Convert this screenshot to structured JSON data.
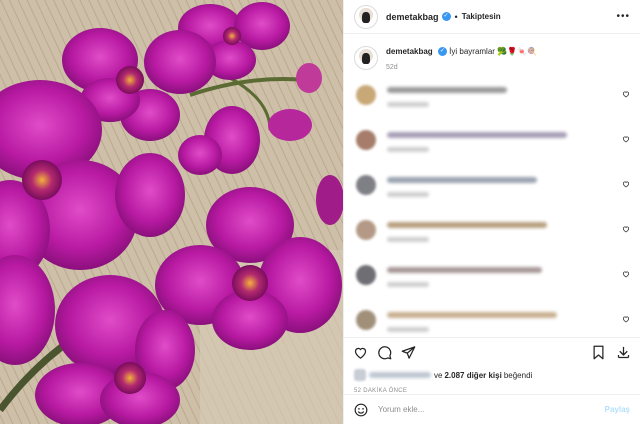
{
  "header": {
    "username": "demetakbag",
    "verified_glyph": "✓",
    "separator": "•",
    "follow_status": "Takiptesin",
    "more_glyph": "•••"
  },
  "caption": {
    "username": "demetakbag",
    "text": "İyi bayramlar",
    "emojis": [
      "broccoli-emoji",
      "rose-emoji",
      "sweets-emoji",
      "lollipop-emoji"
    ],
    "time": "52d"
  },
  "comments": [
    {
      "avatar_color": "#c9a878",
      "text_color": "#9a9a9a",
      "width": 120
    },
    {
      "avatar_color": "#a67c6a",
      "text_color": "#a8a0b8",
      "width": 180
    },
    {
      "avatar_color": "#7f7f86",
      "text_color": "#9aa3b0",
      "width": 150
    },
    {
      "avatar_color": "#b49a86",
      "text_color": "#b8a080",
      "width": 160
    },
    {
      "avatar_color": "#6e6e74",
      "text_color": "#a89898",
      "width": 155
    },
    {
      "avatar_color": "#a0907a",
      "text_color": "#c8b090",
      "width": 170
    }
  ],
  "actions": {
    "like": "heart-icon",
    "comment": "comment-icon",
    "share": "share-icon",
    "save": "bookmark-icon",
    "download": "download-icon"
  },
  "likes": {
    "prefix": "ve",
    "count_text": "2.087 diğer kişi",
    "suffix": "beğendi"
  },
  "time_ago": "52 DAKİKA ÖNCE",
  "add_comment": {
    "placeholder": "Yorum ekle...",
    "share_label": "Paylaş"
  },
  "colors": {
    "accent": "#3897f0",
    "orchid": "#b5179e",
    "muted": "#8e8e8e"
  }
}
